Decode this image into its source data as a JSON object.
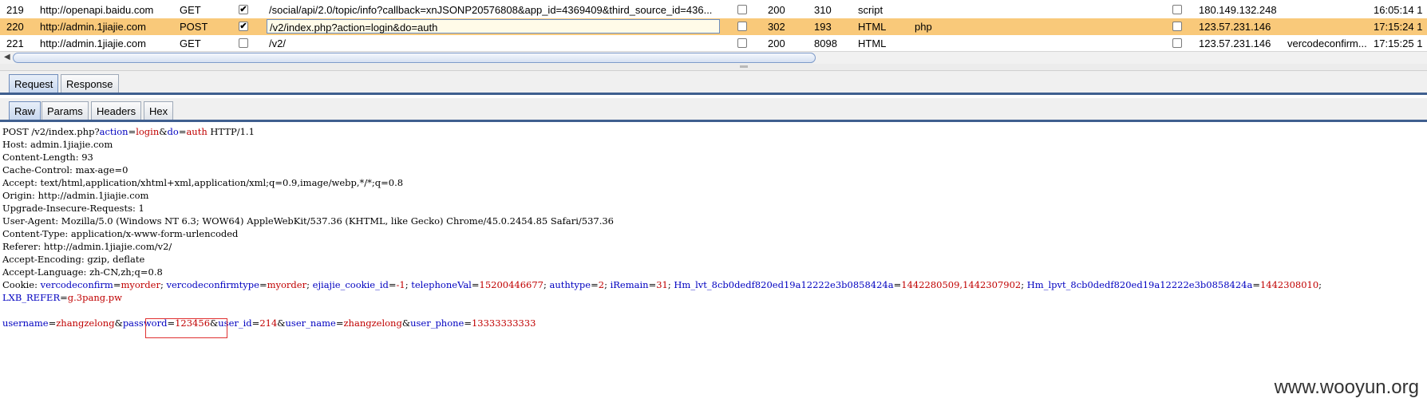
{
  "history": {
    "rows": [
      {
        "num": "219",
        "host": "http://openapi.baidu.com",
        "method": "GET",
        "params": true,
        "url": "/social/api/2.0/topic/info?callback=xnJSONP20576808&app_id=4369409&third_source_id=436...",
        "edited": false,
        "status": "200",
        "length": "310",
        "mime": "script",
        "ext": "",
        "comment": false,
        "ip": "180.149.132.248",
        "cookies": "",
        "time": "16:05:14 1"
      },
      {
        "num": "220",
        "host": "http://admin.1jiajie.com",
        "method": "POST",
        "params": true,
        "url": "/v2/index.php?action=login&do=auth",
        "edited": false,
        "status": "302",
        "length": "193",
        "mime": "HTML",
        "ext": "php",
        "comment": false,
        "ip": "123.57.231.146",
        "cookies": "",
        "time": "17:15:24 1"
      },
      {
        "num": "221",
        "host": "http://admin.1jiajie.com",
        "method": "GET",
        "params": false,
        "url": "/v2/",
        "edited": false,
        "status": "200",
        "length": "8098",
        "mime": "HTML",
        "ext": "",
        "comment": false,
        "ip": "123.57.231.146",
        "cookies": "vercodeconfirm...",
        "time": "17:15:25 1"
      }
    ]
  },
  "tabs": {
    "top": [
      "Request",
      "Response"
    ],
    "sub": [
      "Raw",
      "Params",
      "Headers",
      "Hex"
    ]
  },
  "request": {
    "line1": {
      "a": "POST /v2/index.php?",
      "k1": "action",
      "e1": "=",
      "v1": "login",
      "amp": "&",
      "k2": "do",
      "e2": "=",
      "v2": "auth",
      "tail": " HTTP/1.1"
    },
    "headers": [
      "Host: admin.1jiajie.com",
      "Content-Length: 93",
      "Cache-Control: max-age=0",
      "Accept: text/html,application/xhtml+xml,application/xml;q=0.9,image/webp,*/*;q=0.8",
      "Origin: http://admin.1jiajie.com",
      "Upgrade-Insecure-Requests: 1",
      "User-Agent: Mozilla/5.0 (Windows NT 6.3; WOW64) AppleWebKit/537.36 (KHTML, like Gecko) Chrome/45.0.2454.85 Safari/537.36",
      "Content-Type: application/x-www-form-urlencoded",
      "Referer: http://admin.1jiajie.com/v2/",
      "Accept-Encoding: gzip, deflate",
      "Accept-Language: zh-CN,zh;q=0.8"
    ],
    "cookie_label": "Cookie: ",
    "cookies": [
      {
        "k": "vercodeconfirm",
        "v": "myorder"
      },
      {
        "k": "vercodeconfirmtype",
        "v": "myorder"
      },
      {
        "k": "ejiajie_cookie_id",
        "v": "-1"
      },
      {
        "k": "telephoneVal",
        "v": "15200446677"
      },
      {
        "k": "authtype",
        "v": "2"
      },
      {
        "k": "iRemain",
        "v": "31"
      },
      {
        "k": "Hm_lvt_8cb0dedf820ed19a12222e3b0858424a",
        "v": "1442280509,1442307902"
      },
      {
        "k": "Hm_lpvt_8cb0dedf820ed19a12222e3b0858424a",
        "v": "1442308010"
      }
    ],
    "cookie_wrap": {
      "k": "LXB_REFER",
      "v": "g.3pang.pw"
    },
    "body": [
      {
        "k": "username",
        "v": "zhangzelong"
      },
      {
        "k": "password",
        "v": "123456"
      },
      {
        "k": "user_id",
        "v": "214"
      },
      {
        "k": "user_name",
        "v": "zhangzelong"
      },
      {
        "k": "user_phone",
        "v": "13333333333"
      }
    ]
  },
  "watermark": "www.wooyun.org"
}
